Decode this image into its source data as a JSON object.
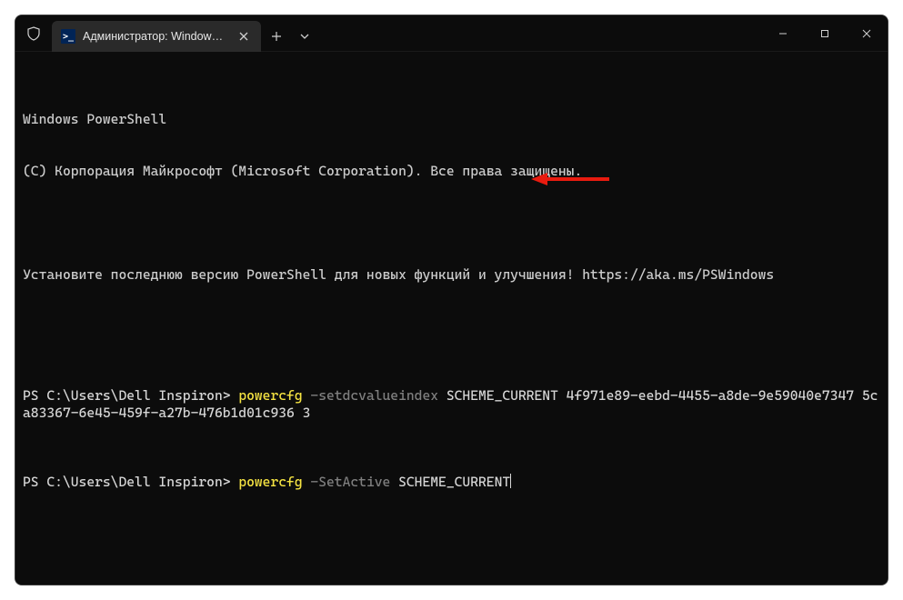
{
  "titlebar": {
    "tab_title": "Администратор: Windows Po",
    "ps_glyph": ">_"
  },
  "terminal": {
    "banner1": "Windows PowerShell",
    "banner2": "(C) Корпорация Майкрософт (Microsoft Corporation). Все права защищены.",
    "hint": "Установите последнюю версию PowerShell для новых функций и улучшения! https://aka.ms/PSWindows",
    "line1": {
      "prompt": "PS C:\\Users\\Dell Inspiron> ",
      "cmd": "powercfg",
      "sw": " -setdcvalueindex",
      "args": " SCHEME_CURRENT 4f971e89-eebd-4455-a8de-9e59040e7347 5ca83367-6e45-459f-a27b-476b1d01c936 3"
    },
    "line2": {
      "prompt": "PS C:\\Users\\Dell Inspiron> ",
      "cmd": "powercfg",
      "sw": " -SetActive",
      "args": " SCHEME_CURRENT"
    }
  },
  "arrow": {
    "color": "#e81b0f"
  }
}
